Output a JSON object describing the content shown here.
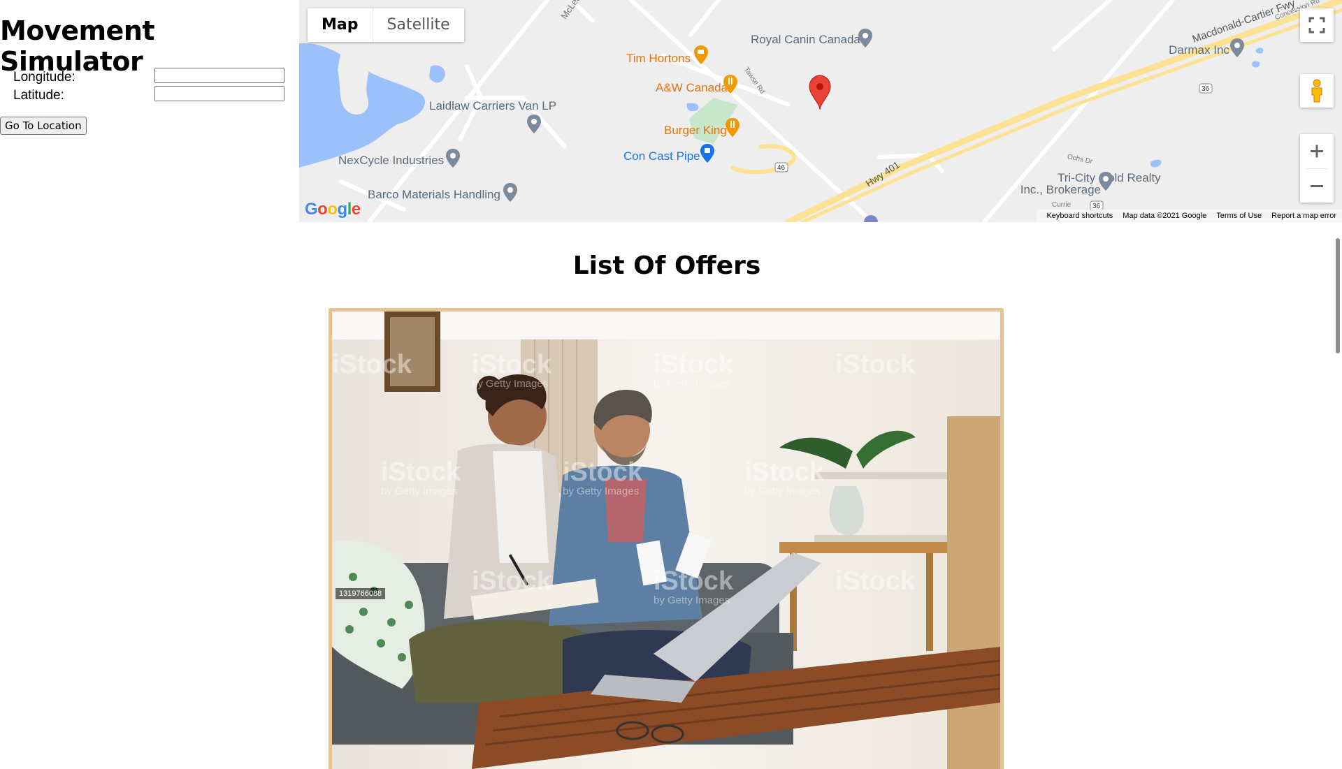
{
  "app": {
    "title": "Movement Simulator"
  },
  "form": {
    "longitude_label": "Longitude:",
    "longitude_value": "",
    "latitude_label": "Latitude:",
    "latitude_value": "",
    "go_button": "Go To Location"
  },
  "map": {
    "type_toggle": {
      "map": "Map",
      "satellite": "Satellite"
    },
    "places": {
      "tim_hortons": "Tim Hortons",
      "aw_canada": "A&W Canada",
      "burger_king": "Burger King",
      "con_cast_pipe": "Con Cast Pipe",
      "royal_canin": "Royal Canin Canada",
      "laidlaw": "Laidlaw Carriers Van LP",
      "nexcycle": "NexCycle Industries",
      "barco": "Barco Materials Handling",
      "darmax": "Darmax Inc",
      "tri_city_1": "Tri-City Gold Realty",
      "tri_city_2": "Inc., Brokerage"
    },
    "roads": {
      "mclean": "McLean Rd W",
      "tawse": "Tawse Rd",
      "hwy401": "Hwy 401",
      "macdonald_cartier": "Macdonald-Cartier Fwy",
      "concession": "Concession Rd",
      "ochs": "Ochs Dr",
      "currie": "Currie",
      "shield_46": "46",
      "shield_36a": "36",
      "shield_36b": "36"
    },
    "logo": "Google",
    "footer": {
      "shortcuts": "Keyboard shortcuts",
      "map_data": "Map data ©2021 Google",
      "terms": "Terms of Use",
      "report": "Report a map error"
    },
    "icons": {
      "fullscreen": "fullscreen-icon",
      "pegman": "pegman-icon",
      "zoom_in": "plus-icon",
      "zoom_out": "minus-icon",
      "marker": "location-marker-icon"
    }
  },
  "offers": {
    "title": "List Of Offers",
    "photo_id": "1319766088",
    "watermarks": {
      "brand": "iStock",
      "byline": "by Getty Images"
    }
  },
  "colors": {
    "card_border": "#e6c395",
    "marker_red": "#ea4335",
    "highway_yellow": "#fde293",
    "water_blue": "#9cc0f9"
  }
}
